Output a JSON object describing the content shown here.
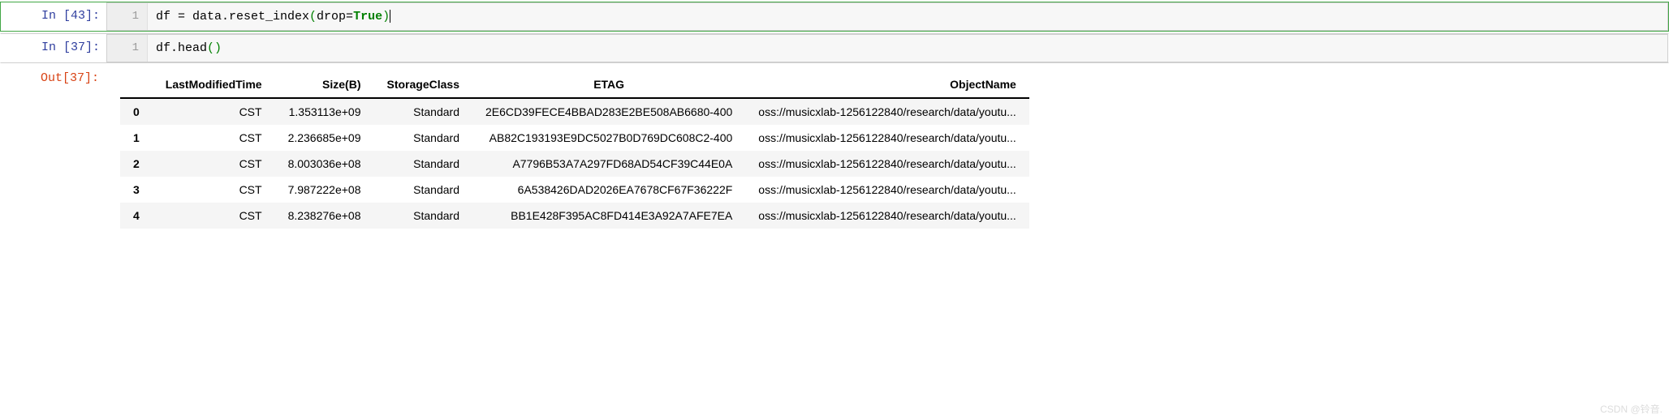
{
  "cells": [
    {
      "in_prompt": "In [43]:",
      "line_no": "1",
      "code_prefix": "df = data.reset_index",
      "code_lparen": "(",
      "code_arg": "drop=",
      "code_kw": "True",
      "code_rparen": ")"
    },
    {
      "in_prompt": "In [37]:",
      "line_no": "1",
      "code_prefix": "df.head",
      "code_lparen": "(",
      "code_rparen": ")"
    }
  ],
  "out_prompt": "Out[37]:",
  "table": {
    "columns": [
      "LastModifiedTime",
      "Size(B)",
      "StorageClass",
      "ETAG",
      "ObjectName"
    ],
    "rows": [
      {
        "idx": "0",
        "LastModifiedTime": "CST",
        "Size": "1.353113e+09",
        "StorageClass": "Standard",
        "ETAG": "2E6CD39FECE4BBAD283E2BE508AB6680-400",
        "ObjectName": "oss://musicxlab-1256122840/research/data/youtu..."
      },
      {
        "idx": "1",
        "LastModifiedTime": "CST",
        "Size": "2.236685e+09",
        "StorageClass": "Standard",
        "ETAG": "AB82C193193E9DC5027B0D769DC608C2-400",
        "ObjectName": "oss://musicxlab-1256122840/research/data/youtu..."
      },
      {
        "idx": "2",
        "LastModifiedTime": "CST",
        "Size": "8.003036e+08",
        "StorageClass": "Standard",
        "ETAG": "A7796B53A7A297FD68AD54CF39C44E0A",
        "ObjectName": "oss://musicxlab-1256122840/research/data/youtu..."
      },
      {
        "idx": "3",
        "LastModifiedTime": "CST",
        "Size": "7.987222e+08",
        "StorageClass": "Standard",
        "ETAG": "6A538426DAD2026EA7678CF67F36222F",
        "ObjectName": "oss://musicxlab-1256122840/research/data/youtu..."
      },
      {
        "idx": "4",
        "LastModifiedTime": "CST",
        "Size": "8.238276e+08",
        "StorageClass": "Standard",
        "ETAG": "BB1E428F395AC8FD414E3A92A7AFE7EA",
        "ObjectName": "oss://musicxlab-1256122840/research/data/youtu..."
      }
    ]
  },
  "watermark": "CSDN @铃音."
}
